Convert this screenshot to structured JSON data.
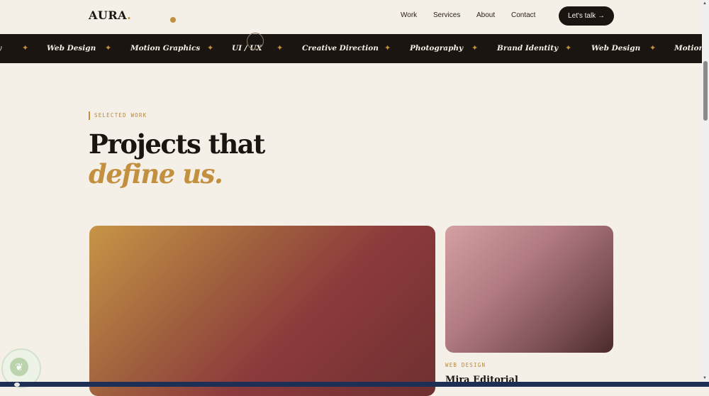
{
  "header": {
    "logo": "AURA",
    "logo_dot": ".",
    "nav": [
      "Work",
      "Services",
      "About",
      "Contact"
    ],
    "cta": "Let's talk →"
  },
  "marquee": {
    "items": [
      "y",
      "Web Design",
      "Motion Graphics",
      "UI / UX",
      "Creative Direction",
      "Photography",
      "Brand Identity",
      "Web Design",
      "Motion G"
    ],
    "separator": "✦"
  },
  "hero": {
    "eyebrow": "SELECTED WORK",
    "title_line1": "Projects that",
    "title_line2": "define us."
  },
  "projects": [
    {
      "category": "",
      "title": ""
    },
    {
      "category": "WEB DESIGN",
      "title": "Mira Editorial"
    }
  ],
  "colors": {
    "background": "#f4efe7",
    "ink": "#1b1511",
    "accent": "#c2903f"
  },
  "icons": {
    "widget": "leaf-icon",
    "scroll_up": "triangle-up-icon",
    "scroll_down": "triangle-down-icon"
  }
}
